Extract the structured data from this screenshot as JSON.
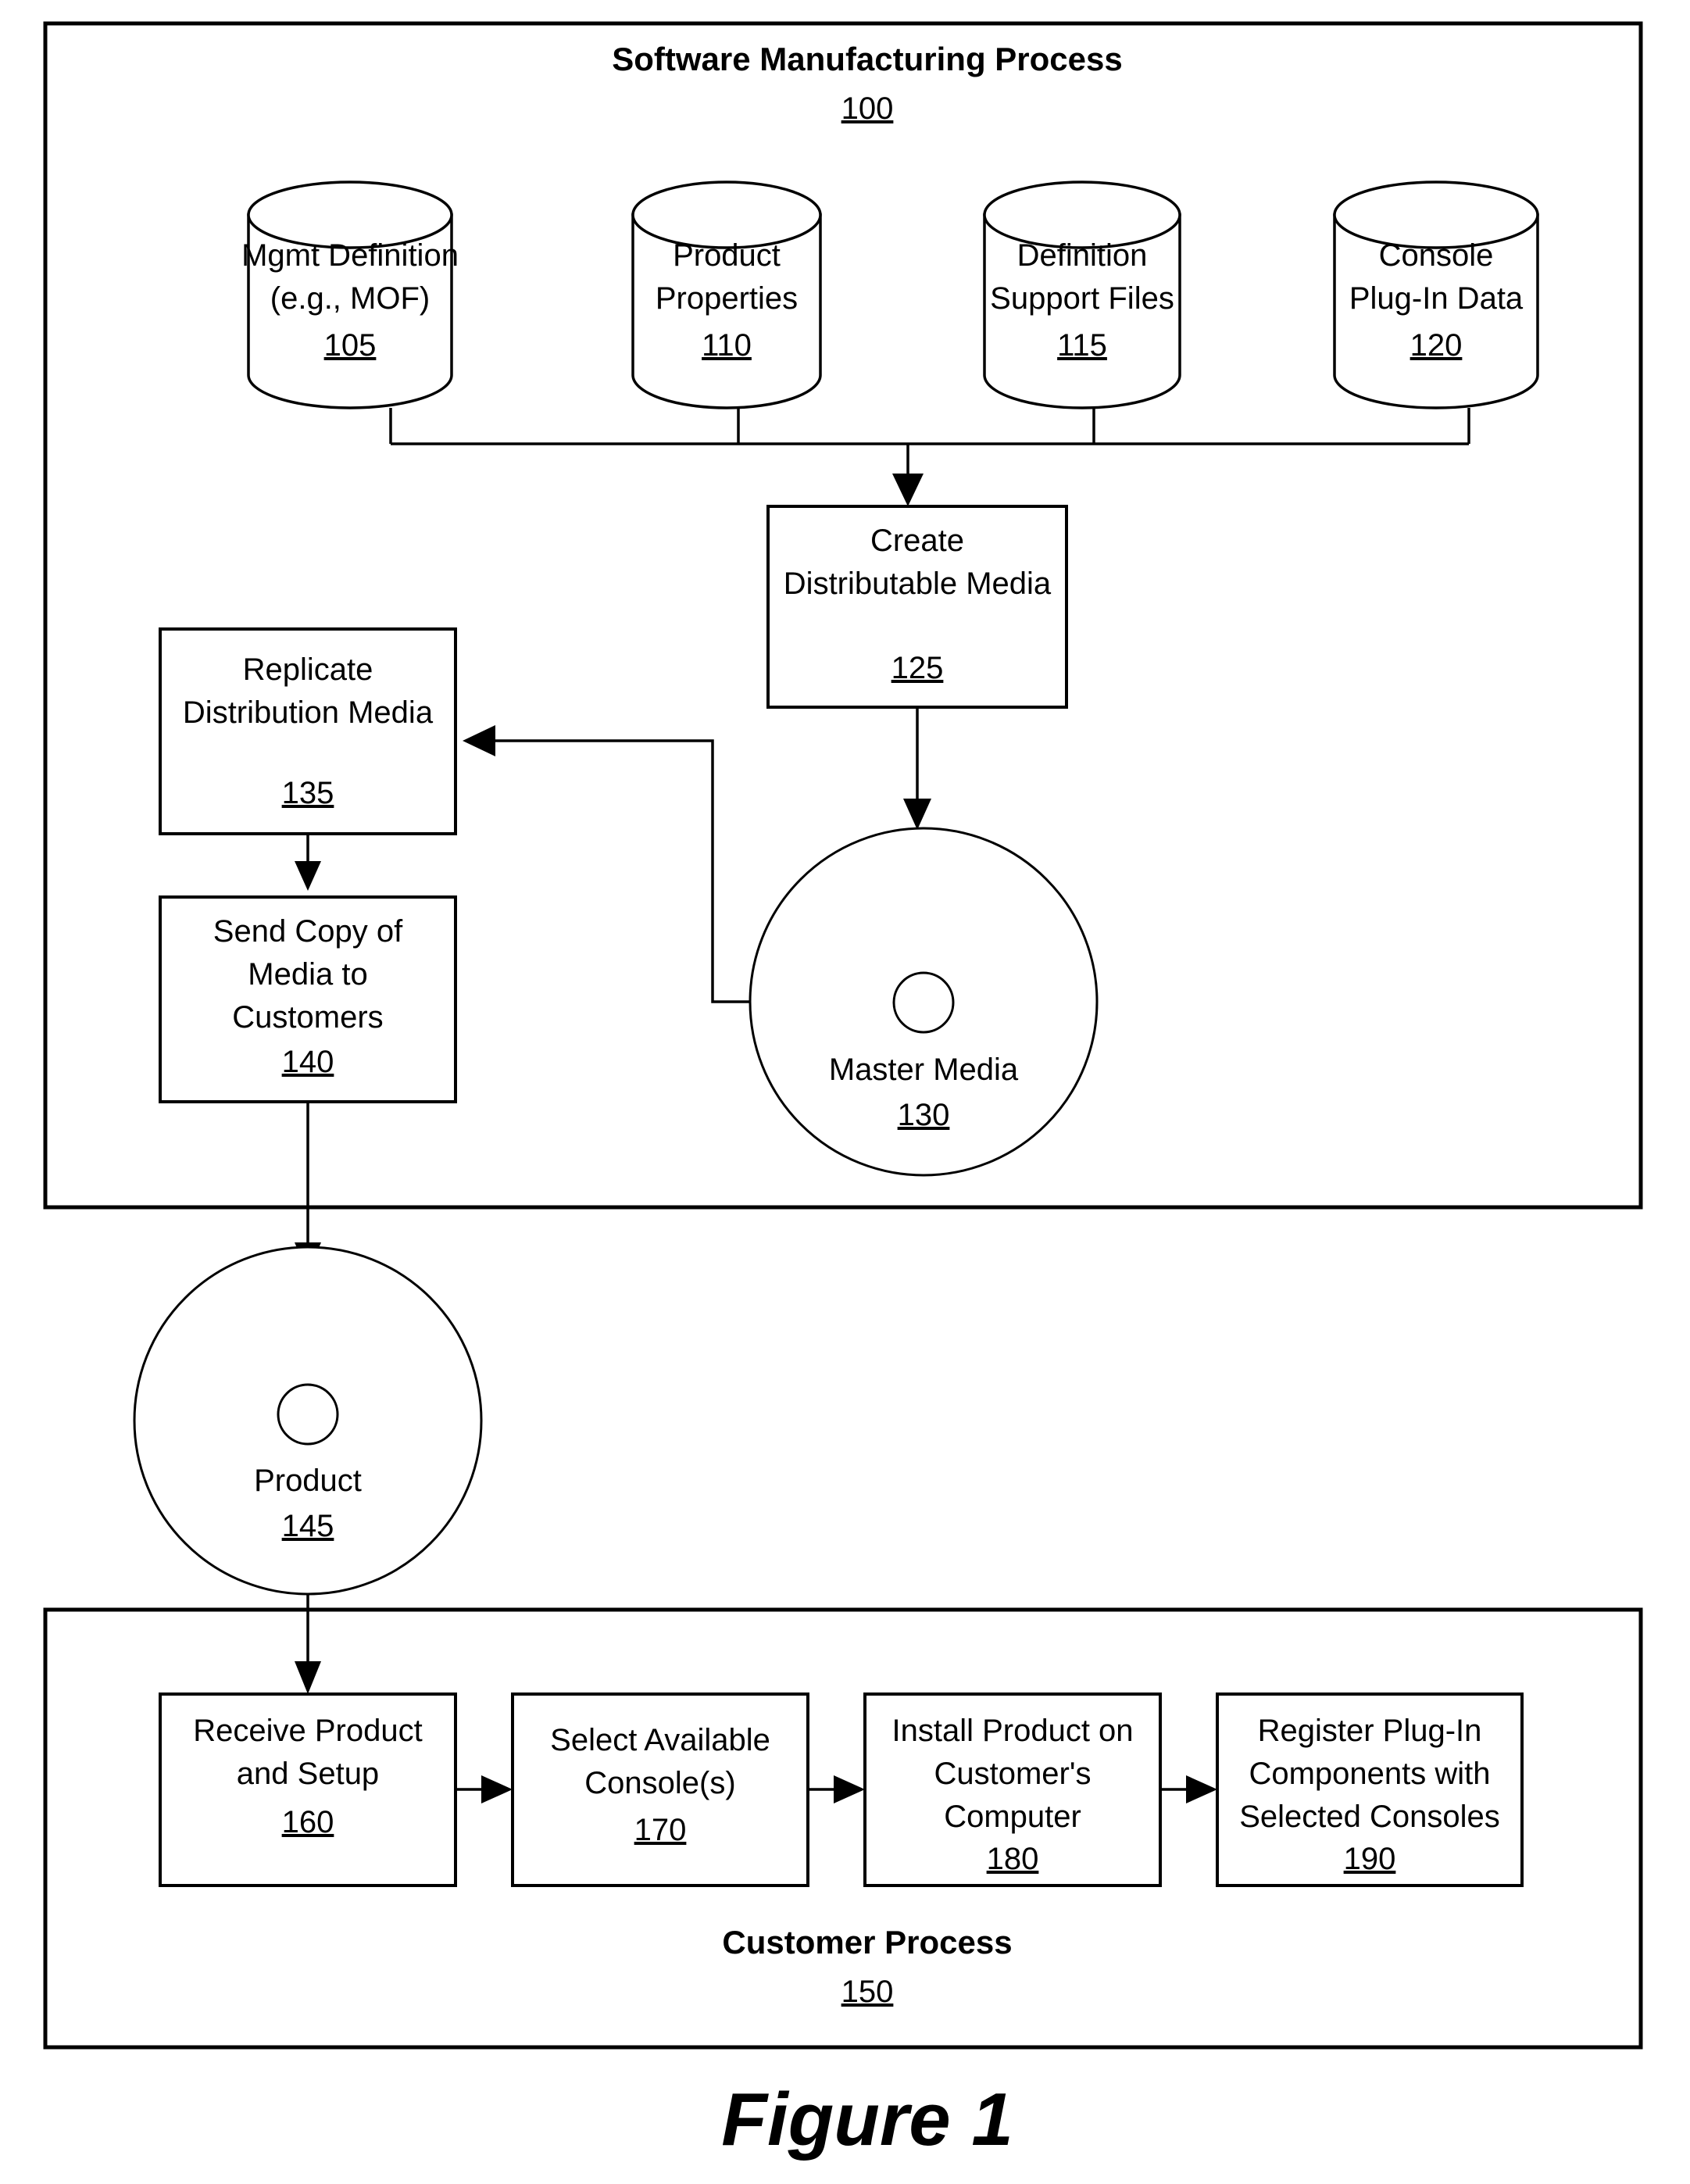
{
  "figure": {
    "caption": "Figure 1"
  },
  "manufacturing_process": {
    "title": "Software Manufacturing Process",
    "ref": "100",
    "sources": [
      {
        "line1": "Mgmt Definition",
        "line2": "(e.g., MOF)",
        "ref": "105"
      },
      {
        "line1": "Product",
        "line2": "Properties",
        "ref": "110"
      },
      {
        "line1": "Definition",
        "line2": "Support Files",
        "ref": "115"
      },
      {
        "line1": "Console",
        "line2": "Plug-In Data",
        "ref": "120"
      }
    ],
    "create_media": {
      "line1": "Create",
      "line2": "Distributable Media",
      "ref": "125"
    },
    "master_media": {
      "label": "Master Media",
      "ref": "130"
    },
    "replicate": {
      "line1": "Replicate",
      "line2": "Distribution Media",
      "ref": "135"
    },
    "send_copy": {
      "line1": "Send Copy of",
      "line2": "Media to",
      "line3": "Customers",
      "ref": "140"
    }
  },
  "product_disc": {
    "label": "Product",
    "ref": "145"
  },
  "customer_process": {
    "title": "Customer Process",
    "ref": "150",
    "steps": [
      {
        "line1": "Receive Product",
        "line2": "and Setup",
        "line3": "",
        "ref": "160"
      },
      {
        "line1": "Select Available",
        "line2": "Console(s)",
        "line3": "",
        "ref": "170"
      },
      {
        "line1": "Install Product on",
        "line2": "Customer's",
        "line3": "Computer",
        "ref": "180"
      },
      {
        "line1": "Register Plug-In",
        "line2": "Components with",
        "line3": "Selected Consoles",
        "ref": "190"
      }
    ]
  }
}
